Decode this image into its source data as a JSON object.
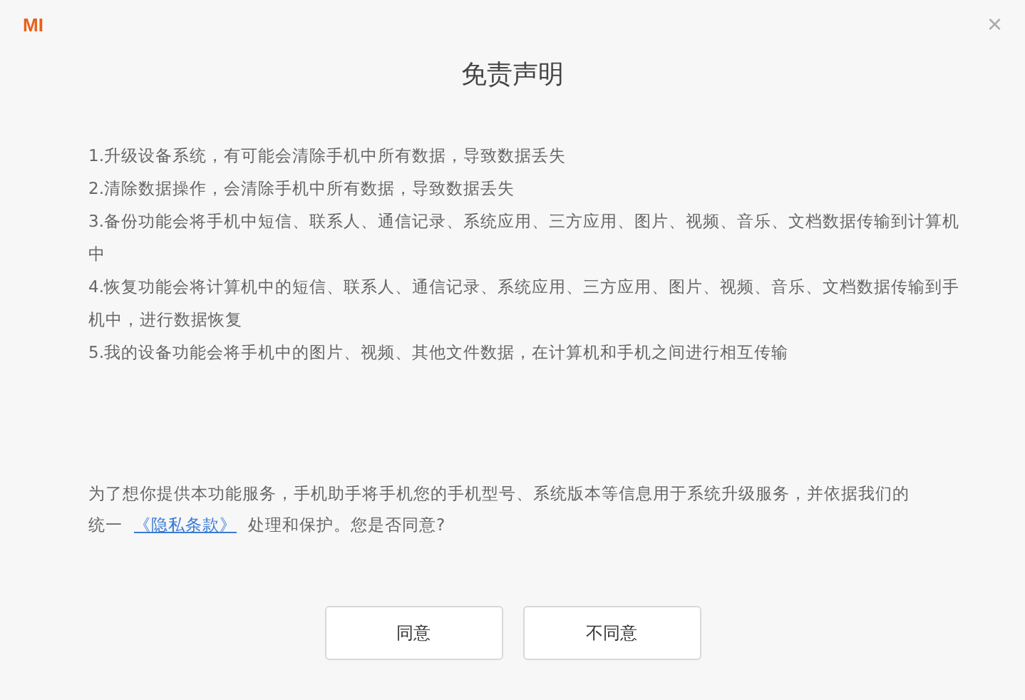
{
  "window": {
    "logo": "MI",
    "close": "×",
    "title": "免责声明"
  },
  "items": [
    "1.升级设备系统，有可能会清除手机中所有数据，导致数据丢失",
    "2.清除数据操作，会清除手机中所有数据，导致数据丢失",
    "3.备份功能会将手机中短信、联系人、通信记录、系统应用、三方应用、图片、视频、音乐、文档数据传输到计算机中",
    "4.恢复功能会将计算机中的短信、联系人、通信记录、系统应用、三方应用、图片、视频、音乐、文档数据传输到手机中，进行数据恢复",
    "5.我的设备功能会将手机中的图片、视频、其他文件数据，在计算机和手机之间进行相互传输"
  ],
  "notice": {
    "line_1": "为了想你提供本功能服务，手机助手将手机您的手机型号、系统版本等信息用于系统升级服务，并依据我们的",
    "line_2_before": "统一",
    "link": "《隐私条款》",
    "line_2_after": "处理和保护。您是否同意?"
  },
  "buttons": [
    "同意",
    "不同意"
  ]
}
